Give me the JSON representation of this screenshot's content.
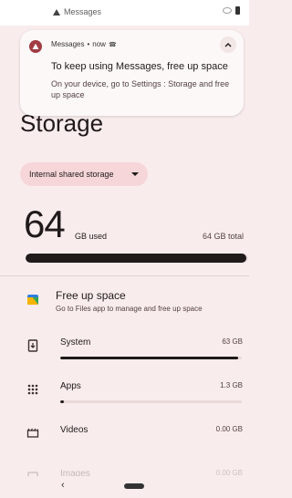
{
  "notification_header_peek": "Messages",
  "notification": {
    "app_name": "Messages",
    "time": "now",
    "title": "To keep using Messages, free up space",
    "body": "On your device, go to Settings : Storage and free up space"
  },
  "page": {
    "title": "Storage",
    "storage_selector": "Internal shared storage",
    "used_value": "64",
    "used_unit": "GB used",
    "total": "64 GB total",
    "used_fraction": 0.99
  },
  "free_up": {
    "title": "Free up space",
    "subtitle": "Go to Files app to manage and free up space"
  },
  "categories": [
    {
      "label": "System",
      "size": "63 GB",
      "icon": "system-icon",
      "fraction": 0.98
    },
    {
      "label": "Apps",
      "size": "1.3 GB",
      "icon": "apps-grid-icon",
      "fraction": 0.02
    },
    {
      "label": "Videos",
      "size": "0.00 GB",
      "icon": "videos-icon",
      "fraction": 0
    },
    {
      "label": "Images",
      "size": "0.00 GB",
      "icon": "images-icon",
      "fraction": 0
    }
  ],
  "nav": {
    "back_glyph": "‹"
  },
  "colors": {
    "background": "#f9ecec",
    "accent": "#a13c44",
    "chip": "#f6d6d9"
  }
}
